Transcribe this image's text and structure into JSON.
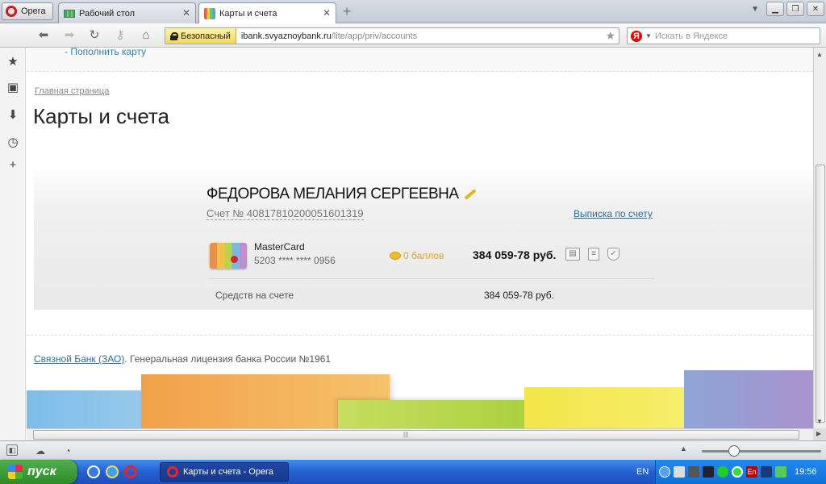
{
  "browser": {
    "menu_label": "Opera",
    "tabs": [
      {
        "label": "Рабочий стол"
      },
      {
        "label": "Карты и счета"
      }
    ],
    "security_label": "Безопасный",
    "url_host": "ibank.svyaznoybank.ru",
    "url_path": "/lite/app/priv/accounts",
    "search_placeholder": "Искать в Яндексе"
  },
  "page": {
    "top_link": "- Пополнить карту",
    "breadcrumb": "Главная страница",
    "title": "Карты и счета"
  },
  "account": {
    "owner": "ФЕДОРОВА МЕЛАНИЯ СЕРГЕЕВНА",
    "number": "Счет № 40817810200051601319",
    "statement_link": "Выписка по счету",
    "card_name": "MasterCard",
    "card_number": "5203 **** **** 0956",
    "points": "0 баллов",
    "balance": "384 059-78 руб.",
    "funds_label": "Средств на счете",
    "funds_value": "384 059-78 руб."
  },
  "footer": {
    "bank_link": "Связной Банк (ЗАО)",
    "license": ". Генеральная лицензия банка России №1961"
  },
  "taskbar": {
    "start_label": "пуск",
    "task_label": "Карты и счета - Opera",
    "lang": "EN",
    "clock": "19:56"
  }
}
